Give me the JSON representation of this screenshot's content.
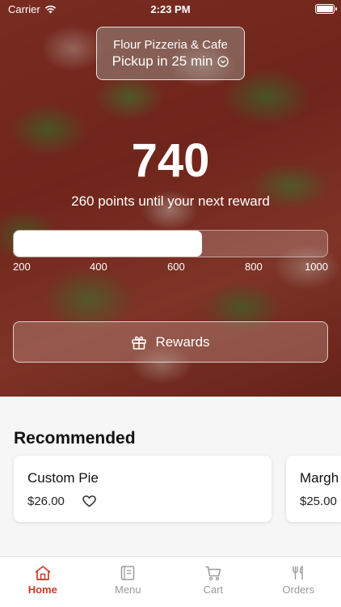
{
  "status_bar": {
    "carrier": "Carrier",
    "time": "2:23 PM"
  },
  "store": {
    "name": "Flour Pizzeria & Cafe",
    "pickup": "Pickup in 25 min"
  },
  "loyalty": {
    "points": "740",
    "subtitle": "260 points until your next reward",
    "progress_value": 740,
    "progress_min": 200,
    "progress_max": 1000,
    "ticks": [
      "200",
      "400",
      "600",
      "800",
      "1000"
    ]
  },
  "rewards_button": {
    "label": "Rewards"
  },
  "recommended": {
    "title": "Recommended",
    "items": [
      {
        "name": "Custom Pie",
        "price": "$26.00"
      },
      {
        "name": "Margh",
        "price": "$25.00"
      }
    ]
  },
  "tabbar": {
    "tabs": [
      {
        "label": "Home",
        "icon": "home-icon",
        "active": true
      },
      {
        "label": "Menu",
        "icon": "menu-icon",
        "active": false
      },
      {
        "label": "Cart",
        "icon": "cart-icon",
        "active": false
      },
      {
        "label": "Orders",
        "icon": "orders-icon",
        "active": false
      }
    ]
  },
  "colors": {
    "accent": "#c43f25",
    "inactive": "#9a9a9a"
  }
}
